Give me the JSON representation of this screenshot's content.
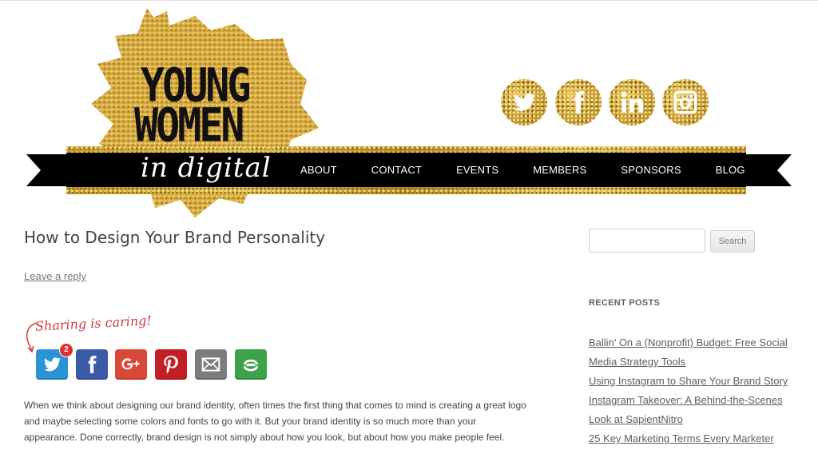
{
  "brand": {
    "logo_line1": "YOUNG",
    "logo_line2": "WOMEN",
    "logo_script": "in digital",
    "colors": {
      "gold": "#d4a63a",
      "ribbon": "#000000"
    }
  },
  "nav": {
    "items": [
      {
        "label": "ABOUT"
      },
      {
        "label": "CONTACT"
      },
      {
        "label": "EVENTS"
      },
      {
        "label": "MEMBERS"
      },
      {
        "label": "SPONSORS"
      },
      {
        "label": "BLOG"
      }
    ]
  },
  "social": {
    "icons": [
      "twitter-icon",
      "facebook-icon",
      "linkedin-icon",
      "instagram-icon"
    ]
  },
  "post": {
    "title": "How to Design Your Brand Personality",
    "leave_reply": "Leave a reply",
    "sharing_caring": "Sharing is caring!",
    "twitter_count": "2",
    "share_buttons": [
      {
        "icon": "twitter-icon",
        "color": "#2a94d6"
      },
      {
        "icon": "facebook-icon",
        "color": "#3b5ba6"
      },
      {
        "icon": "google-plus-icon",
        "color": "#d8493a"
      },
      {
        "icon": "pinterest-icon",
        "color": "#c51f26"
      },
      {
        "icon": "email-icon",
        "color": "#7c7c7c"
      },
      {
        "icon": "share-more-icon",
        "color": "#3ea24b"
      }
    ],
    "body": "When we think about designing our brand identity, often times the first thing that comes to mind is creating a great logo and maybe selecting some colors and fonts to go with it. But your brand identity is so much more than your appearance. Done correctly, brand design is not simply about how you look, but about how you make people feel."
  },
  "sidebar": {
    "search_placeholder": "",
    "search_button": "Search",
    "recent_heading": "RECENT POSTS",
    "recent_posts": [
      {
        "title": "Ballin’ On a (Nonprofit) Budget: Free Social Media Strategy Tools"
      },
      {
        "title": "Using Instagram to Share Your Brand Story"
      },
      {
        "title": "Instagram Takeover: A Behind-the-Scenes Look at SapientNitro"
      },
      {
        "title": "25 Key Marketing Terms Every Marketer"
      }
    ]
  }
}
